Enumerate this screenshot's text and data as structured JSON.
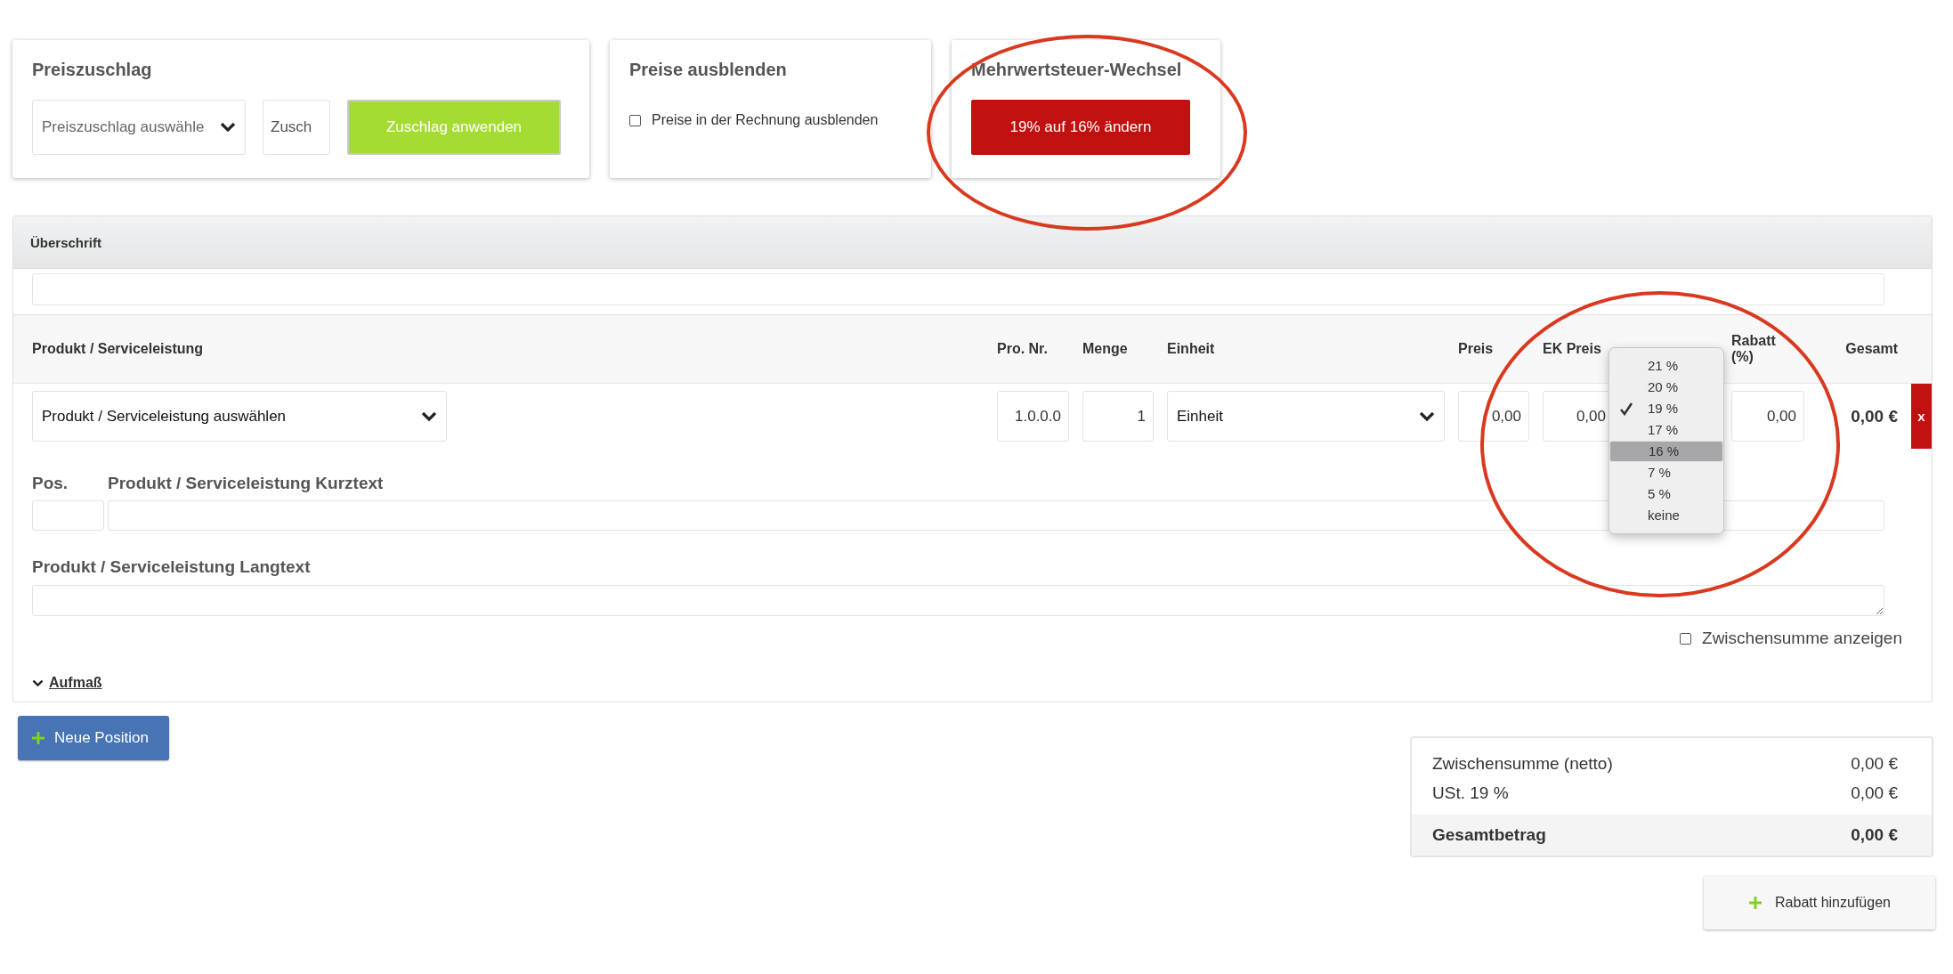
{
  "surcharge_card": {
    "title": "Preiszuschlag",
    "select": {
      "placeholder": "Preiszuschlag auswähle"
    },
    "input": {
      "placeholder": "Zusch"
    },
    "button": "Zuschlag anwenden"
  },
  "hide_prices_card": {
    "title": "Preise ausblenden",
    "checkbox": {
      "label": "Preise in der Rechnung ausblenden",
      "checked": false
    }
  },
  "vat_card": {
    "title": "Mehrwertsteuer-Wechsel",
    "button": "19% auf 16% ändern"
  },
  "position_panel": {
    "heading": "Überschrift",
    "columns": [
      "Produkt / Serviceleistung",
      "Pro. Nr.",
      "Menge",
      "Einheit",
      "Preis",
      "EK Preis",
      "Rabatt (%)",
      "Gesamt"
    ],
    "row": {
      "product_select": "Produkt / Serviceleistung auswählen",
      "pro_nr": "1.0.0.0",
      "menge": "1",
      "einheit": "Einheit",
      "preis": "0,00",
      "ek_preis": "0,00",
      "rabatt": "0,00",
      "gesamt": "0,00 €",
      "delete": "x"
    },
    "pos_label": "Pos.",
    "kurztext_label": "Produkt / Serviceleistung Kurztext",
    "langtext_label": "Produkt / Serviceleistung Langtext",
    "subtotal_checkbox": {
      "label": "Zwischensumme anzeigen",
      "checked": false
    },
    "aufmass": "Aufmaß"
  },
  "tax_menu": {
    "items": [
      {
        "label": "21 %",
        "checked": false,
        "selected": false
      },
      {
        "label": "20 %",
        "checked": false,
        "selected": false
      },
      {
        "label": "19 %",
        "checked": true,
        "selected": false
      },
      {
        "label": "17 %",
        "checked": false,
        "selected": false
      },
      {
        "label": "16 %",
        "checked": false,
        "selected": true
      },
      {
        "label": "7 %",
        "checked": false,
        "selected": false
      },
      {
        "label": "5 %",
        "checked": false,
        "selected": false
      },
      {
        "label": "keine",
        "checked": false,
        "selected": false
      }
    ]
  },
  "new_position_button": "Neue Position",
  "totals": {
    "rows": [
      {
        "label": "Zwischensumme (netto)",
        "value": "0,00 €",
        "kind": "line"
      },
      {
        "label": "USt. 19 %",
        "value": "0,00 €",
        "kind": "line"
      },
      {
        "label": "Gesamtbetrag",
        "value": "0,00 €",
        "kind": "total"
      }
    ]
  },
  "discount_button": "Rabatt hinzufügen"
}
